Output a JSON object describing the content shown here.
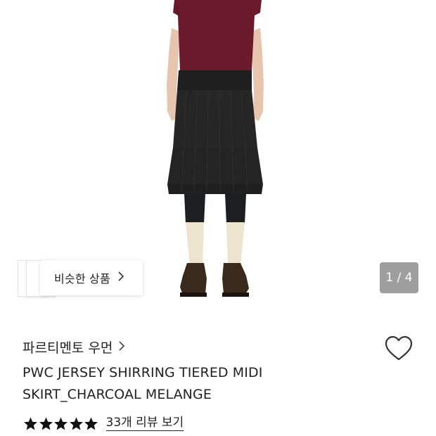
{
  "product_image": {
    "alt": "Model wearing charcoal tiered midi skirt"
  },
  "similar_products": {
    "label": "비슷한 상품",
    "icon": "chevron-right-icon"
  },
  "image_counter": {
    "text": "1 / 4",
    "current": 1,
    "total": 4
  },
  "product": {
    "brand": "파르티멘토 우먼",
    "brand_icon": "chevron-right-icon",
    "title_line1": "PWC JERSEY SHIRRING TIERED MIDI",
    "title_line2": "SKIRT_CHARCOAL MELANGE",
    "wishlist_icon": "heart-outline-icon",
    "rating": {
      "stars": 5,
      "max": 5,
      "reviews_text": "33개 리뷰 보기"
    }
  },
  "colors": {
    "top": "#6b1a2c",
    "skirt": "#232323",
    "socks": "#ece4cf",
    "shoes": "#3a2a1e",
    "counter_bg": "#787878"
  }
}
